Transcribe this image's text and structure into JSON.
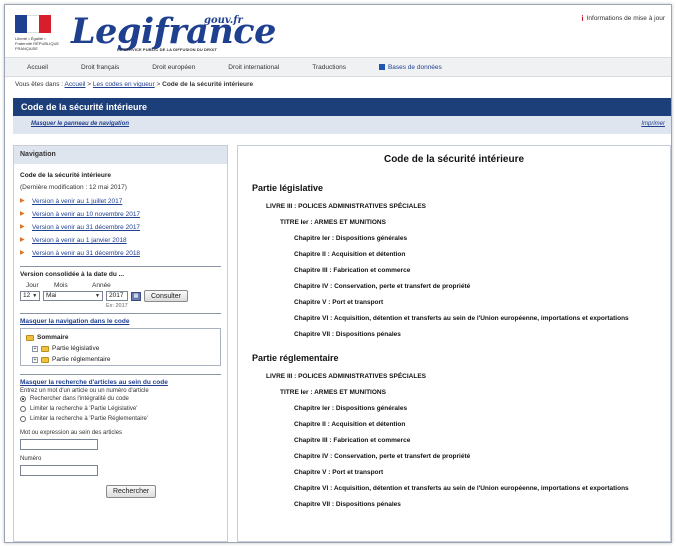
{
  "header": {
    "brand": "Legifrance",
    "brand_suffix": "gouv.fr",
    "tagline": "LE SERVICE PUBLIC DE LA DIFFUSION DU DROIT",
    "republic_text": "Liberté • Égalité • Fraternité RÉPUBLIQUE FRANÇAISE",
    "info_link": "Informations de mise à jour"
  },
  "topnav": {
    "items": [
      "Accueil",
      "Droit français",
      "Droit européen",
      "Droit international",
      "Traductions",
      "Bases de données"
    ]
  },
  "breadcrumb": {
    "prefix": "Vous êtes dans :",
    "link1": "Accueil",
    "sep": ">",
    "link2": "Les codes en vigueur",
    "current": "Code de la sécurité intérieure"
  },
  "titlebar": {
    "title": "Code de la sécurité intérieure",
    "hide_nav": "Masquer le panneau de navigation",
    "print": "Imprimer"
  },
  "sidebar": {
    "heading": "Navigation",
    "code_title": "Code de la sécurité intérieure",
    "last_modified": "(Dernière modification : 12 mai 2017)",
    "versions": [
      "Version à venir au 1 juillet 2017",
      "Version à venir au 10 novembre 2017",
      "Version à venir au 31 décembre 2017",
      "Version à venir au 1 janvier 2018",
      "Version à venir au 31 décembre 2018"
    ],
    "consolidated_title": "Version consolidée à la date du ...",
    "date_labels": {
      "day": "Jour",
      "month": "Mois",
      "year": "Année"
    },
    "date_values": {
      "day": "12",
      "month": "Mai",
      "year": "2017"
    },
    "date_example": "Ex: 2017",
    "consult_button": "Consulter",
    "mask_nav_link": "Masquer la navigation dans le code",
    "tree": {
      "root": "Sommaire",
      "children": [
        "Partie législative",
        "Partie réglementaire"
      ]
    },
    "mask_search_link": "Masquer la recherche d'articles au sein du code",
    "search_hint": "Entrez un mot d'un article ou un numéro d'article",
    "radios": [
      "Rechercher dans l'intégralité du code",
      "Limiter la recherche à 'Partie Législative'",
      "Limiter la recherche à 'Partie Réglementaire'"
    ],
    "expression_label": "Mot ou expression au sein des articles",
    "number_label": "Numéro",
    "search_button": "Rechercher"
  },
  "main": {
    "title": "Code de la sécurité intérieure",
    "parts": [
      {
        "name": "Partie législative",
        "livre": "LIVRE III : POLICES ADMINISTRATIVES SPÉCIALES",
        "titre": "TITRE Ier : ARMES ET MUNITIONS",
        "chapters": [
          "Chapitre Ier : Dispositions générales",
          "Chapitre II : Acquisition et détention",
          "Chapitre III : Fabrication et commerce",
          "Chapitre IV : Conservation, perte et transfert de propriété",
          "Chapitre V : Port et transport",
          "Chapitre VI : Acquisition, détention et transferts au sein de l'Union européenne, importations et exportations",
          "Chapitre VII : Dispositions pénales"
        ]
      },
      {
        "name": "Partie réglementaire",
        "livre": "LIVRE III : POLICES ADMINISTRATIVES SPÉCIALES",
        "titre": "TITRE Ier : ARMES ET MUNITIONS",
        "chapters": [
          "Chapitre Ier : Dispositions générales",
          "Chapitre II : Acquisition et détention",
          "Chapitre III : Fabrication et commerce",
          "Chapitre IV : Conservation, perte et transfert de propriété",
          "Chapitre V : Port et transport",
          "Chapitre VI : Acquisition, détention et transferts au sein de l'Union européenne, importations et exportations",
          "Chapitre VII : Dispositions pénales"
        ]
      }
    ]
  },
  "colors": {
    "brand_blue": "#1f3f8f",
    "titlebar": "#1d3f79",
    "accent_orange": "#e07020"
  }
}
